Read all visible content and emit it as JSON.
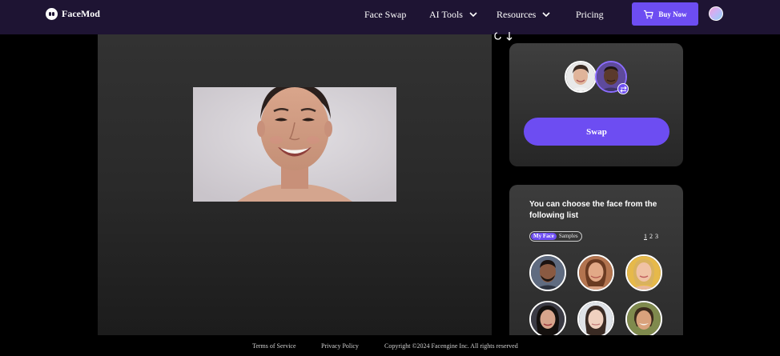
{
  "header": {
    "brand": "FaceMod",
    "nav": [
      {
        "label": "Face Swap",
        "dropdown": false
      },
      {
        "label": "AI Tools",
        "dropdown": true
      },
      {
        "label": "Resources",
        "dropdown": true
      },
      {
        "label": "Pricing",
        "dropdown": false
      }
    ],
    "buy_label": "Buy Now"
  },
  "swap": {
    "button_label": "Swap"
  },
  "face_list": {
    "heading": "You can choose the face from the following list",
    "tabs": [
      "My Face",
      "Samples"
    ],
    "active_tab": "My Face",
    "pages": [
      "1",
      "2",
      "3"
    ],
    "current_page": "1"
  },
  "footer": {
    "terms": "Terms of Service",
    "privacy": "Privacy Policy",
    "copyright": "Copyright ©2024  Facengine Inc. All rights reserved"
  },
  "colors": {
    "nav_bg": "#1e1433",
    "accent": "#6d4df2",
    "panel": "#333333",
    "background": "#000000"
  }
}
